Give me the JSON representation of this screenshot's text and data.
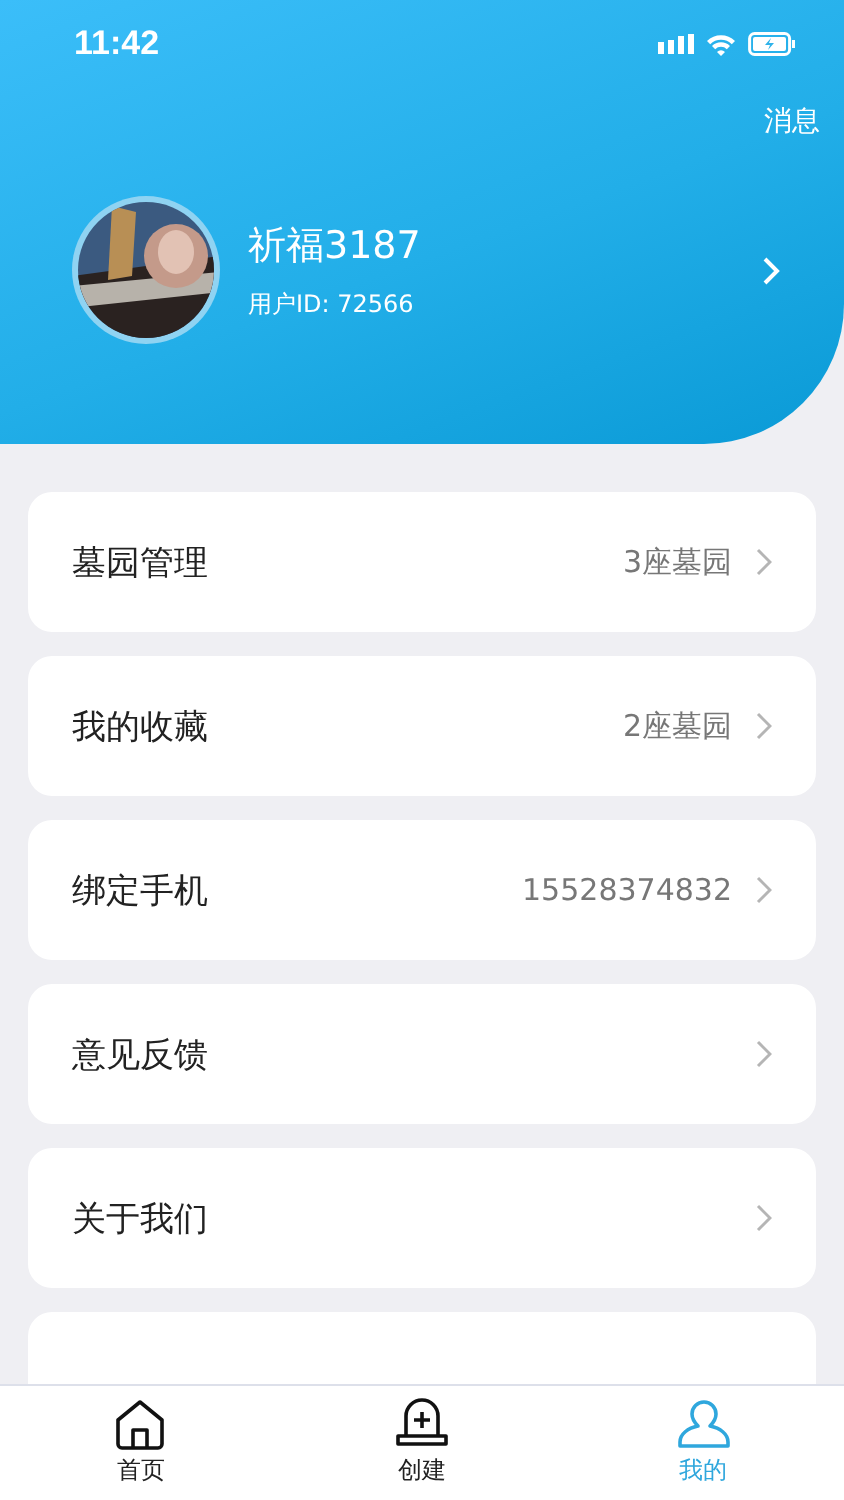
{
  "status_bar": {
    "time": "11:42"
  },
  "header": {
    "message_link": "消息",
    "user": {
      "name": "祈福3187",
      "id_label": "用户ID: 72566"
    }
  },
  "menu": [
    {
      "label": "墓园管理",
      "value": "3座墓园"
    },
    {
      "label": "我的收藏",
      "value": "2座墓园"
    },
    {
      "label": "绑定手机",
      "value": "15528374832"
    },
    {
      "label": "意见反馈"
    },
    {
      "label": "关于我们"
    }
  ],
  "tab_bar": [
    {
      "kind": "home",
      "label": "首页",
      "selected": false
    },
    {
      "kind": "create",
      "label": "创建",
      "selected": false
    },
    {
      "kind": "profile",
      "label": "我的",
      "selected": true
    }
  ]
}
